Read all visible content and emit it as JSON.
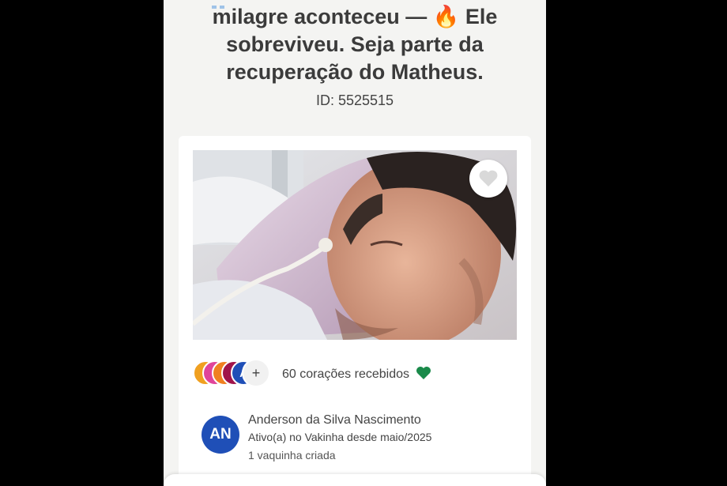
{
  "campaign": {
    "title_lines": [
      "milagre aconteceu — 🔥 Ele",
      "sobreviveu. Seja parte da",
      "recuperação do Matheus."
    ],
    "id_text": "ID: 5525515"
  },
  "photo": {
    "favorite_icon": "heart-icon"
  },
  "supporters": {
    "avatars": [
      {
        "initial": "",
        "color": "#f0a020"
      },
      {
        "initial": "",
        "color": "#e0449a"
      },
      {
        "initial": "",
        "color": "#f08020"
      },
      {
        "initial": "",
        "color": "#a0144a"
      },
      {
        "initial": "A",
        "color": "#1f4fb7"
      }
    ],
    "more_label": "+",
    "hearts_text": "60 corações recebidos",
    "heart_color": "#1a8a4a"
  },
  "creator": {
    "initials": "AN",
    "name": "Anderson da Silva Nascimento",
    "since": "Ativo(a) no Vakinha desde maio/2025",
    "count": "1 vaquinha criada"
  }
}
